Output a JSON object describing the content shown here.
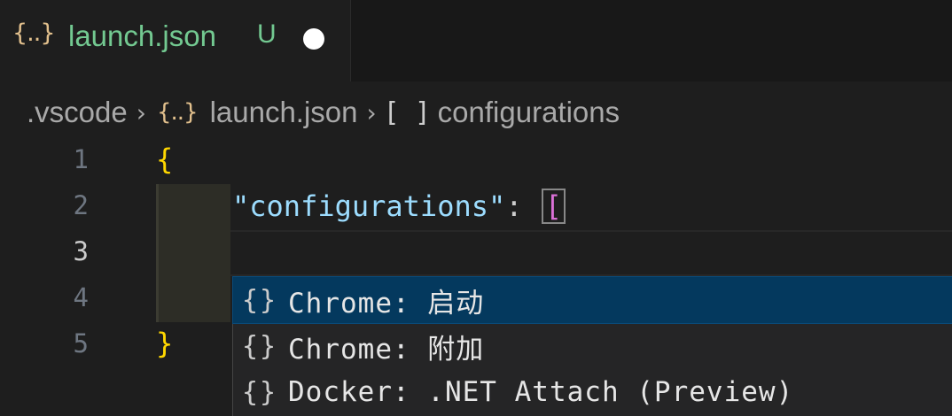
{
  "tab": {
    "icon_glyph": "{..}",
    "icon": "json-file-icon",
    "title": "launch.json",
    "git_status": "U",
    "dirty": true,
    "colors": {
      "title": "#73c991",
      "icon": "#e2c08d"
    }
  },
  "breadcrumb": {
    "folder": ".vscode",
    "file_icon_glyph": "{..}",
    "file": "launch.json",
    "array_icon_glyph": "[ ]",
    "symbol": "configurations",
    "separator": "›"
  },
  "editor": {
    "lines": [
      {
        "number": "1",
        "open_brace": "{"
      },
      {
        "number": "2",
        "key": "\"configurations\"",
        "colon": ":",
        "bracket": "["
      },
      {
        "number": "3"
      },
      {
        "number": "4"
      },
      {
        "number": "5",
        "close_brace": "}"
      }
    ],
    "active_line": "3"
  },
  "suggestions": {
    "items": [
      {
        "icon_glyph": "{}",
        "icon": "snippet-braces-icon",
        "label": "Chrome: 启动",
        "selected": true
      },
      {
        "icon_glyph": "{}",
        "icon": "snippet-braces-icon",
        "label": "Chrome: 附加",
        "selected": false
      },
      {
        "icon_glyph": "{}",
        "icon": "snippet-braces-icon",
        "label": "Docker: .NET Attach (Preview)",
        "selected": false
      }
    ],
    "colors": {
      "selected_bg": "#04395e"
    }
  }
}
